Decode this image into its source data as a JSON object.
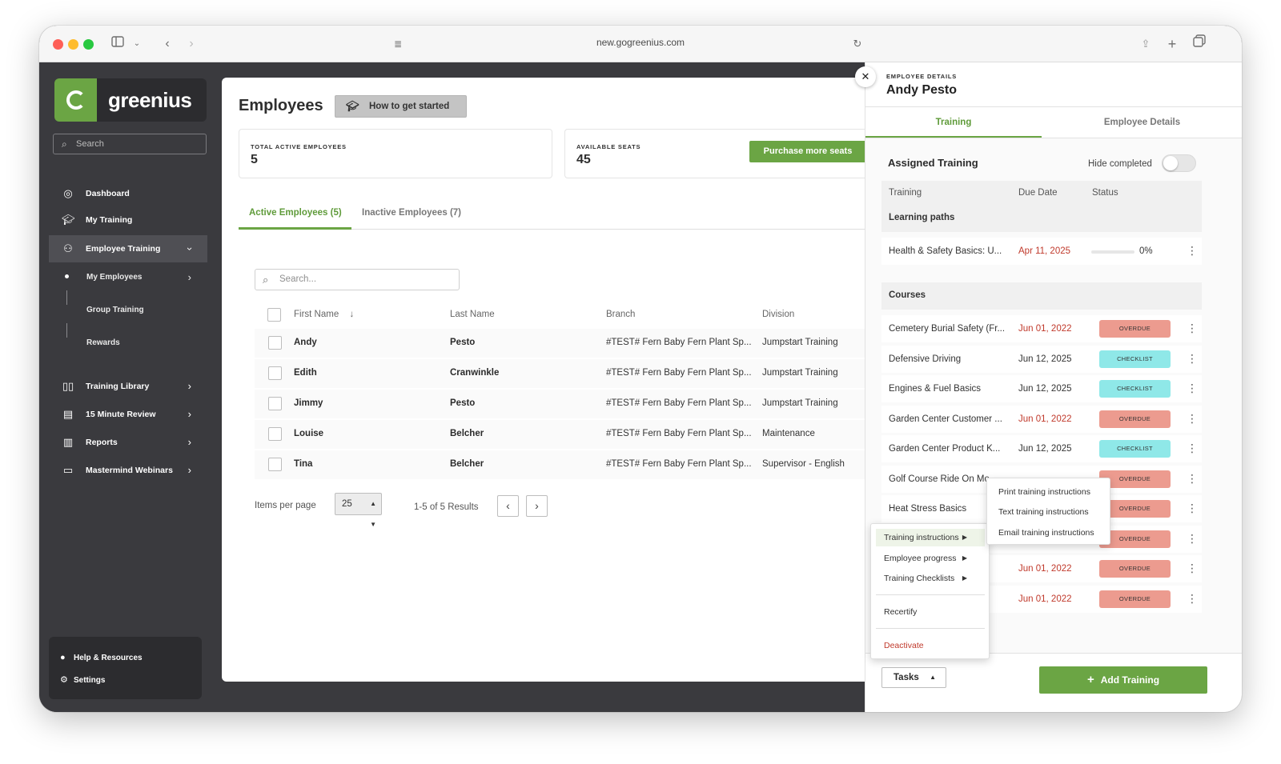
{
  "browser": {
    "url": "new.gogreenius.com"
  },
  "sidebar": {
    "brand": "greenius",
    "search_placeholder": "Search",
    "nav": [
      {
        "label": "Dashboard",
        "icon": "dashboard-icon"
      },
      {
        "label": "My Training",
        "icon": "graduation-cap-icon"
      },
      {
        "label": "Employee Training",
        "icon": "users-icon",
        "expanded": true
      },
      {
        "label": "Training Library",
        "icon": "book-icon"
      },
      {
        "label": "15 Minute Review",
        "icon": "document-icon"
      },
      {
        "label": "Reports",
        "icon": "report-icon"
      },
      {
        "label": "Mastermind Webinars",
        "icon": "video-icon"
      }
    ],
    "sub_nav": [
      {
        "label": "My Employees"
      },
      {
        "label": "Group Training"
      },
      {
        "label": "Rewards"
      }
    ],
    "bottom": [
      {
        "label": "Help & Resources"
      },
      {
        "label": "Settings"
      }
    ]
  },
  "main": {
    "title": "Employees",
    "howto_label": "How to get started",
    "stats": {
      "total_label": "TOTAL ACTIVE EMPLOYEES",
      "total_value": "5",
      "seats_label": "AVAILABLE SEATS",
      "seats_value": "45",
      "purchase_label": "Purchase more seats"
    },
    "tabs": [
      {
        "label": "Active Employees (5)",
        "active": true
      },
      {
        "label": "Inactive Employees (7)",
        "active": false
      }
    ],
    "search_placeholder": "Search...",
    "columns": [
      "First Name",
      "Last Name",
      "Branch",
      "Division"
    ],
    "rows": [
      {
        "first": "Andy",
        "last": "Pesto",
        "branch": "#TEST# Fern Baby Fern Plant Sp...",
        "division": "Jumpstart Training"
      },
      {
        "first": "Edith",
        "last": "Cranwinkle",
        "branch": "#TEST# Fern Baby Fern Plant Sp...",
        "division": "Jumpstart Training"
      },
      {
        "first": "Jimmy",
        "last": "Pesto",
        "branch": "#TEST# Fern Baby Fern Plant Sp...",
        "division": "Jumpstart Training"
      },
      {
        "first": "Louise",
        "last": "Belcher",
        "branch": "#TEST# Fern Baby Fern Plant Sp...",
        "division": "Maintenance"
      },
      {
        "first": "Tina",
        "last": "Belcher",
        "branch": "#TEST# Fern Baby Fern Plant Sp...",
        "division": "Supervisor - English"
      }
    ],
    "pager": {
      "items_label": "Items per page",
      "items_value": "25",
      "results": "1-5 of 5 Results"
    }
  },
  "drawer": {
    "kicker": "EMPLOYEE DETAILS",
    "name": "Andy Pesto",
    "tabs": [
      {
        "label": "Training",
        "active": true
      },
      {
        "label": "Employee Details",
        "active": false
      }
    ],
    "assigned_title": "Assigned Training",
    "hide_completed_label": "Hide completed",
    "hide_completed_on": false,
    "columns": [
      "Training",
      "Due Date",
      "Status"
    ],
    "learning_paths_label": "Learning paths",
    "learning_paths": [
      {
        "name": "Health & Safety Basics: U...",
        "due": "Apr 11, 2025",
        "progress": 0,
        "progress_label": "0%"
      }
    ],
    "courses_label": "Courses",
    "courses": [
      {
        "name": "Cemetery Burial Safety (Fr...",
        "due": "Jun 01, 2022",
        "status": "OVERDUE"
      },
      {
        "name": "Defensive Driving",
        "due": "Jun 12, 2025",
        "status": "CHECKLIST"
      },
      {
        "name": "Engines & Fuel Basics",
        "due": "Jun 12, 2025",
        "status": "CHECKLIST"
      },
      {
        "name": "Garden Center Customer ...",
        "due": "Jun 01, 2022",
        "status": "OVERDUE"
      },
      {
        "name": "Garden Center Product K...",
        "due": "Jun 12, 2025",
        "status": "CHECKLIST"
      },
      {
        "name": "Golf Course Ride On Mo...",
        "due": "",
        "status": "OVERDUE"
      },
      {
        "name": "Heat Stress Basics",
        "due": "",
        "status": "OVERDUE"
      },
      {
        "name": "",
        "due": "",
        "status": "OVERDUE"
      },
      {
        "name": "",
        "due": "Jun 01, 2022",
        "status": "OVERDUE"
      },
      {
        "name": "",
        "due": "Jun 01, 2022",
        "status": "OVERDUE"
      }
    ],
    "tasks_label": "Tasks",
    "add_training_label": "Add Training",
    "tasks_menu": [
      {
        "label": "Training instructions",
        "submenu": true
      },
      {
        "label": "Employee progress",
        "submenu": true
      },
      {
        "label": "Training Checklists",
        "submenu": true
      },
      {
        "label": "Recertify",
        "submenu": false
      },
      {
        "label": "Deactivate",
        "submenu": false
      }
    ],
    "instructions_menu": [
      {
        "label": "Print training instructions"
      },
      {
        "label": "Text training instructions"
      },
      {
        "label": "Email training instructions"
      }
    ]
  },
  "colors": {
    "brand_green": "#6ba544",
    "sidebar_bg": "#3a3a3e",
    "overdue": "#ec9b8f",
    "checklist": "#8fe8e8",
    "danger": "#c0392b"
  }
}
